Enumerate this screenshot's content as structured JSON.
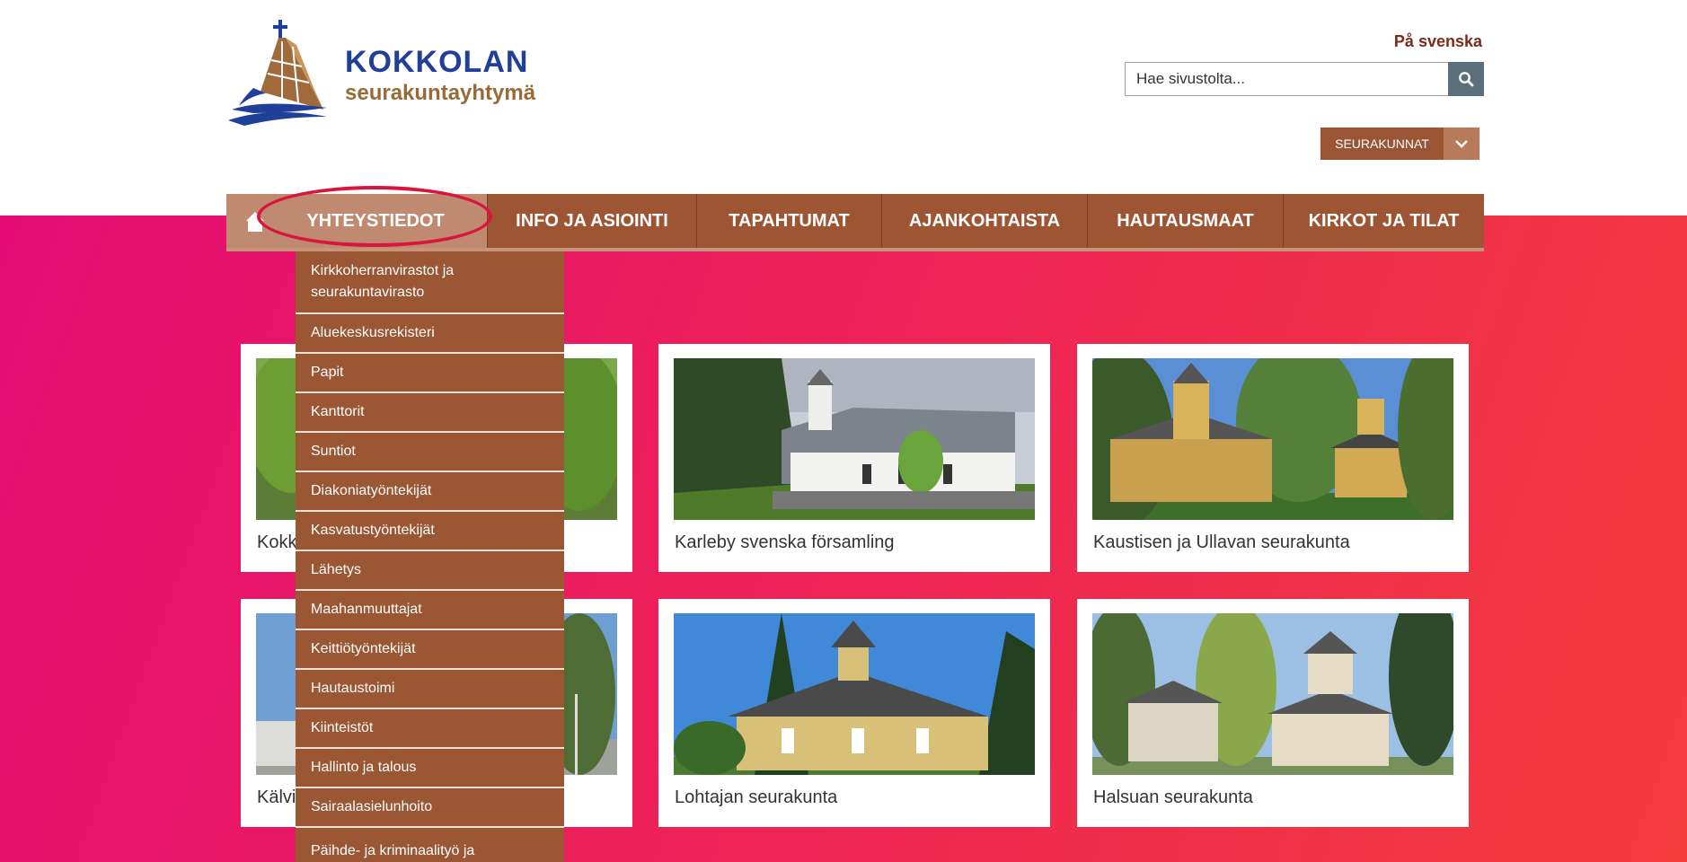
{
  "header": {
    "logo_title": "KOKKOLAN",
    "logo_subtitle": "seurakuntayhtymä",
    "language_link": "På svenska",
    "search_placeholder": "Hae sivustolta...",
    "parishes_dropdown": "SEURAKUNNAT"
  },
  "nav": {
    "items": [
      {
        "label": "YHTEYSTIEDOT",
        "active": true
      },
      {
        "label": "INFO JA ASIOINTI"
      },
      {
        "label": "TAPAHTUMAT"
      },
      {
        "label": "AJANKOHTAISTA"
      },
      {
        "label": "HAUTAUSMAAT"
      },
      {
        "label": "KIRKOT JA TILAT"
      }
    ]
  },
  "dropdown": {
    "items": [
      "Kirkkoherranvirastot ja seurakuntavirasto",
      "Aluekeskusrekisteri",
      "Papit",
      "Kanttorit",
      "Suntiot",
      "Diakoniatyöntekijät",
      "Kasvatustyöntekijät",
      "Lähetys",
      "Maahanmuuttajat",
      "Keittiötyöntekijät",
      "Hautaustoimi",
      "Kiinteistöt",
      "Hallinto ja talous",
      "Sairaalasielunhoito",
      "Päihde- ja kriminaalityö ja"
    ]
  },
  "cards": [
    {
      "title": "Kokk"
    },
    {
      "title": "Karleby svenska församling"
    },
    {
      "title": "Kaustisen ja Ullavan seurakunta"
    },
    {
      "title": "Kälvi"
    },
    {
      "title": "Lohtajan seurakunta"
    },
    {
      "title": "Halsuan seurakunta"
    }
  ],
  "colors": {
    "brand_brown": "#9e5534",
    "brand_blue": "#1f3f99",
    "gradient_start": "#e40c74",
    "gradient_end": "#f33c3c",
    "highlight_circle": "#d8153d"
  },
  "icons": [
    "logo-ship-icon",
    "search-icon",
    "chevron-down-icon",
    "home-icon"
  ]
}
